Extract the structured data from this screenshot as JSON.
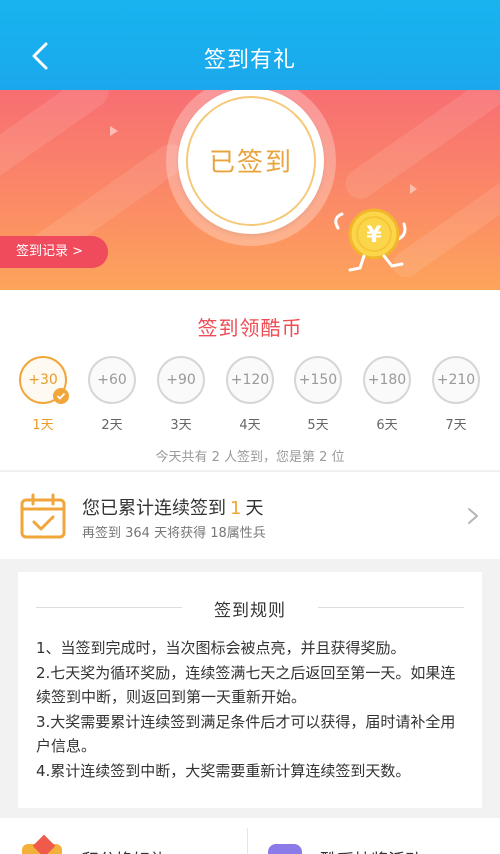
{
  "header": {
    "title": "签到有礼"
  },
  "banner": {
    "status": "已签到",
    "record_label": "签到记录 >"
  },
  "sign": {
    "title": "签到领酷币",
    "days": [
      {
        "reward": "+30",
        "label": "1天",
        "active": true
      },
      {
        "reward": "+60",
        "label": "2天",
        "active": false
      },
      {
        "reward": "+90",
        "label": "3天",
        "active": false
      },
      {
        "reward": "+120",
        "label": "4天",
        "active": false
      },
      {
        "reward": "+150",
        "label": "5天",
        "active": false
      },
      {
        "reward": "+180",
        "label": "6天",
        "active": false
      },
      {
        "reward": "+210",
        "label": "7天",
        "active": false
      }
    ],
    "today_info": "今天共有 2 人签到，您是第 2 位"
  },
  "streak": {
    "prefix": "您已累计连续签到",
    "count": "1",
    "suffix": "天",
    "sub": "再签到 364 天将获得 18属性兵"
  },
  "rules": {
    "title": "签到规则",
    "items": [
      "1、当签到完成时，当次图标会被点亮，并且获得奖励。",
      "2.七天奖为循环奖励，连续签满七天之后返回至第一天。如果连续签到中断，则返回到第一天重新开始。",
      "3.大奖需要累计连续签到满足条件后才可以获得，届时请补全用户信息。",
      "4.累计连续签到中断，大奖需要重新计算连续签到天数。"
    ]
  },
  "bottom": {
    "card1_label": "积分换好礼",
    "card2_label": "酷币抽奖活动"
  },
  "colors": {
    "header": "#18b4f0",
    "accent_orange": "#f0a63a",
    "accent_red": "#ee4d55"
  }
}
